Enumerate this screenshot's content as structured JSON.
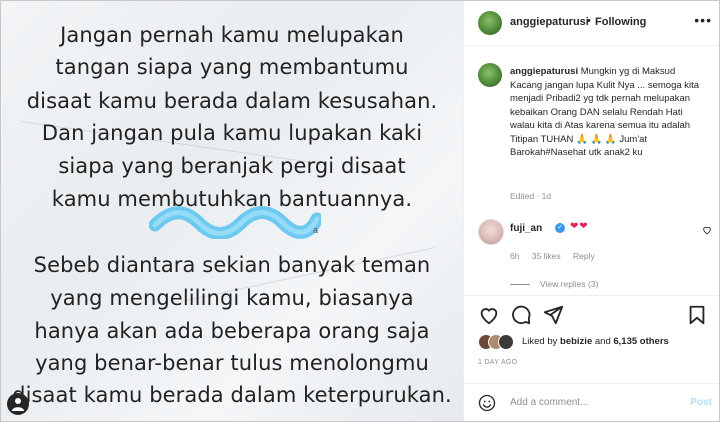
{
  "post": {
    "quote_lines": [
      "Jangan pernah kamu melupakan",
      "tangan siapa yang membantumu",
      "disaat kamu berada dalam kesusahan.",
      "Dan jangan pula kamu lupakan kaki",
      "siapa yang beranjak pergi disaat",
      "kamu membutuhkan bantuannya.",
      "Sebeb diantara sekian banyak teman",
      "yang mengelilingi kamu, biasanya",
      "hanya akan ada beberapa orang saja",
      "yang benar-benar tulus menolongmu",
      "disaat kamu berada dalam keterpurukan."
    ],
    "blurred_suffix": "a"
  },
  "header": {
    "username": "anggiepaturusi",
    "separator": "•",
    "follow_status": "Following",
    "more_icon": "more-horizontal-icon"
  },
  "caption": {
    "username": "anggiepaturusi",
    "text": "Mungkin yg di Maksud Kacang jangan lupa Kulit Nya ... semoga kita menjadi Pribadi2 yg tdk pernah melupakan kebaikan Orang DAN selalu Rendah Hati walau kita di Atas karena semua itu adalah Titipan TUHAN 🙏 🙏 🙏 Jum'at Barokah#Nasehat utk anak2 ku",
    "meta": "Edited · 1d"
  },
  "comment": {
    "username": "fuji_an",
    "hearts": "❤❤",
    "time": "6h",
    "likes": "35 likes",
    "reply": "Reply",
    "view_replies": "View replies (3)"
  },
  "likes": {
    "prefix": "Liked by",
    "user": "bebizie",
    "middle": "and",
    "others": "6,135 others"
  },
  "timestamp": "1 DAY AGO",
  "add_comment": {
    "placeholder": "Add a comment...",
    "post_label": "Post"
  },
  "colors": {
    "accent": "#3897f0",
    "post_disabled": "#b2dffc",
    "heart": "#e0245e",
    "muted": "#8e8e8e"
  }
}
